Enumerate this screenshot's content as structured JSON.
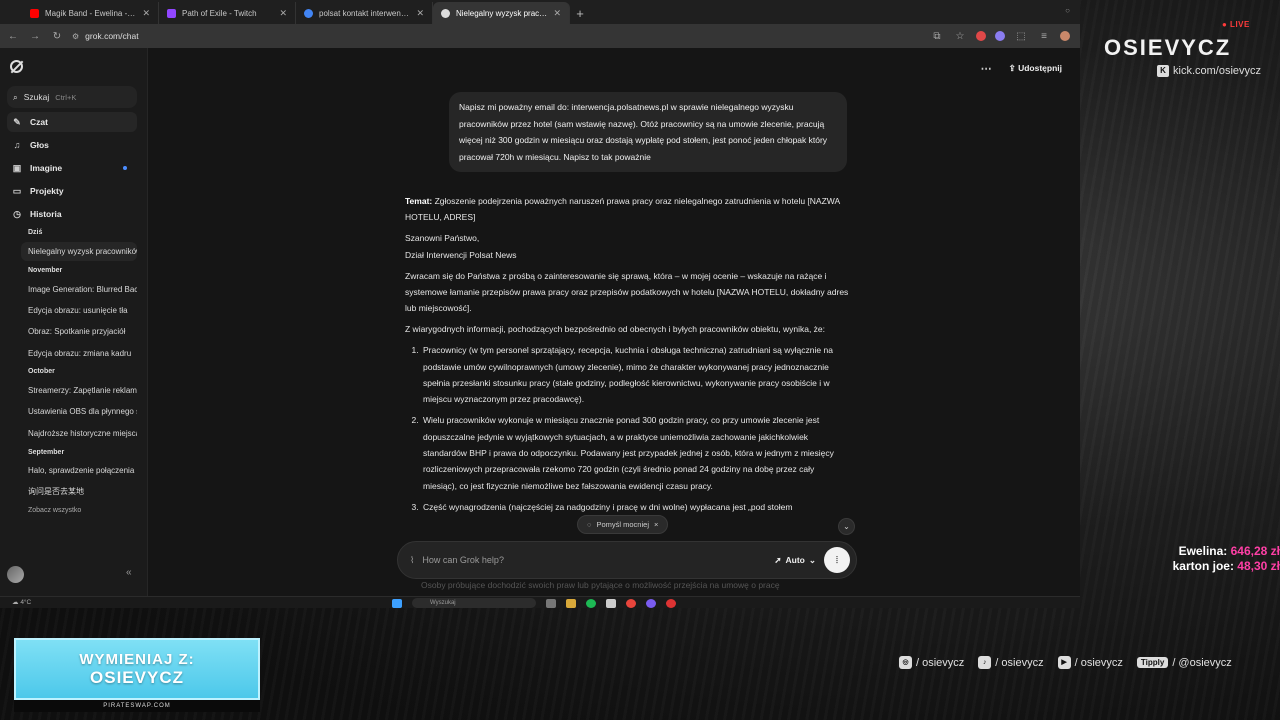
{
  "tabs": [
    {
      "title": "Magik Band - Ewelina - YouTube",
      "color": "#ff0000",
      "active": false
    },
    {
      "title": "Path of Exile - Twitch",
      "color": "#9146ff",
      "active": false
    },
    {
      "title": "polsat kontakt interwencja - Szukaj",
      "color": "#4285f4",
      "active": false
    },
    {
      "title": "Nielegalny wyzysk pracowników",
      "color": "#dddddd",
      "active": true
    }
  ],
  "newtab_label": "+",
  "address": {
    "url": "grok.com/chat"
  },
  "sidebar": {
    "search_label": "Szukaj",
    "search_hint": "Ctrl+K",
    "nav": [
      {
        "label": "Czat",
        "icon": "chat-icon",
        "glyph": "✎"
      },
      {
        "label": "Głos",
        "icon": "voice-icon",
        "glyph": "♫"
      },
      {
        "label": "Imagine",
        "icon": "image-icon",
        "glyph": "▣"
      },
      {
        "label": "Projekty",
        "icon": "folder-icon",
        "glyph": "▭"
      },
      {
        "label": "Historia",
        "icon": "history-icon",
        "glyph": "◷"
      }
    ],
    "groups": {
      "today": "Dziś",
      "november": "November",
      "october": "October",
      "september": "September"
    },
    "history": {
      "today": [
        "Nielegalny wyzysk pracowników"
      ],
      "november": [
        "Image Generation: Blurred Background",
        "Edycja obrazu: usunięcie tła",
        "Obraz: Spotkanie przyjaciół",
        "Edycja obrazu: zmiana kadru"
      ],
      "october": [
        "Streamerzy: Zapętlanie reklam",
        "Ustawienia OBS dla płynnego streamu",
        "Najdroższe historyczne miejsca"
      ],
      "september": [
        "Halo, sprawdzenie połączenia",
        "询问是否去某地"
      ]
    },
    "see_all": "Zobacz wszystko"
  },
  "topbar": {
    "share_label": "Udostępnij"
  },
  "user_message": "Napisz mi poważny email do: interwencja.polsatnews.pl w sprawie nielegalnego wyzysku pracowników przez hotel (sam wstawię nazwę). Otóż pracownicy są na umowie zlecenie, pracują więcej niż 300 godzin w miesiącu oraz dostają wypłatę pod stołem, jest ponoć jeden chłopak który pracował 720h w miesiącu. Napisz to tak poważnie",
  "response": {
    "subject_label": "Temat:",
    "subject_text": " Zgłoszenie podejrzenia poważnych naruszeń prawa pracy oraz nielegalnego zatrudnienia w hotelu [NAZWA HOTELU, ADRES]",
    "greeting_1": "Szanowni Państwo,",
    "greeting_2": "Dział Interwencji Polsat News",
    "intro": "Zwracam się do Państwa z prośbą o zainteresowanie się sprawą, która – w mojej ocenie – wskazuje na rażące i systemowe łamanie przepisów prawa pracy oraz przepisów podatkowych w hotelu [NAZWA HOTELU, dokładny adres lub miejscowość].",
    "source": "Z wiarygodnych informacji, pochodzących bezpośrednio od obecnych i byłych pracowników obiektu, wynika, że:",
    "points": [
      "Pracownicy (w tym personel sprzątający, recepcja, kuchnia i obsługa techniczna) zatrudniani są wyłącznie na podstawie umów cywilnoprawnych (umowy zlecenie), mimo że charakter wykonywanej pracy jednoznacznie spełnia przesłanki stosunku pracy (stałe godziny, podległość kierownictwu, wykonywanie pracy osobiście i w miejscu wyznaczonym przez pracodawcę).",
      "Wielu pracowników wykonuje w miesiącu znacznie ponad 300 godzin pracy, co przy umowie zlecenie jest dopuszczalne jedynie w wyjątkowych sytuacjach, a w praktyce uniemożliwia zachowanie jakichkolwiek standardów BHP i prawa do odpoczynku. Podawany jest przypadek jednej z osób, która w jednym z miesięcy rozliczeniowych przepracowała rzekomo 720 godzin (czyli średnio ponad 24 godziny na dobę przez cały miesiąc), co jest fizycznie niemożliwe bez fałszowania ewidencji czasu pracy.",
      "Część wynagrodzenia (najczęściej za nadgodziny i pracę w dni wolne) wypłacana jest „pod stołem"
    ]
  },
  "think_chip": "Pomyśl mocniej",
  "composer": {
    "placeholder": "How can Grok help?",
    "mode": "Auto"
  },
  "ghost_line": "Osoby próbujące dochodzić swoich praw lub pytające o możliwość przejścia na umowę o pracę",
  "taskbar": {
    "temperature": "4°C",
    "search": "Wyszukaj"
  },
  "stream": {
    "live": "● LIVE",
    "brand": "OSIEVYCZ",
    "kick": "kick.com/osievycz",
    "donations": [
      {
        "name": "Ewelina:",
        "amount": "646,28 zł"
      },
      {
        "name": "karton joe:",
        "amount": "48,30 zł"
      }
    ],
    "banner_line1": "WYMIENIAJ Z:",
    "banner_line2": "OSIEVYCZ",
    "banner_url": "PIRATESWAP.COM",
    "socials": [
      {
        "icon": "instagram-icon",
        "glyph": "◎",
        "handle": "/ osievycz"
      },
      {
        "icon": "tiktok-icon",
        "glyph": "♪",
        "handle": "/ osievycz"
      },
      {
        "icon": "youtube-icon",
        "glyph": "▶",
        "handle": "/ osievycz"
      }
    ],
    "tipply_label": "Tipply",
    "tipply_handle": "/ @osievycz"
  },
  "colors": {
    "accent_pink": "#ff3fa6",
    "live_red": "#ff3b3b",
    "banner_cyan": "#4cc8ea"
  }
}
